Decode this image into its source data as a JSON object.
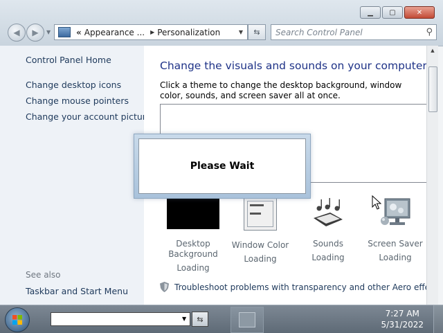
{
  "window": {
    "caption_buttons": [
      "minimize",
      "maximize",
      "close"
    ],
    "nav": {
      "back_icon": "back-arrow-icon",
      "forward_icon": "forward-arrow-icon"
    },
    "address": {
      "overflow": "«",
      "crumbs": [
        "Appearance ...",
        "Personalization"
      ]
    },
    "search": {
      "placeholder": "Search Control Panel"
    }
  },
  "left_pane": {
    "home": "Control Panel Home",
    "links": [
      "Change desktop icons",
      "Change mouse pointers",
      "Change your account picture"
    ],
    "see_also_heading": "See also",
    "see_also": [
      "Taskbar and Start Menu"
    ]
  },
  "content": {
    "heading": "Change the visuals and sounds on your computer",
    "instruction": "Click a theme to change the desktop background, window color, sounds, and screen saver all at once.",
    "tiles": [
      {
        "label": "Desktop Background",
        "status": "Loading"
      },
      {
        "label": "Window Color",
        "status": "Loading"
      },
      {
        "label": "Sounds",
        "status": "Loading"
      },
      {
        "label": "Screen Saver",
        "status": "Loading"
      }
    ],
    "aero_link": "Troubleshoot problems with transparency and other Aero effects"
  },
  "dialog": {
    "message": "Please Wait"
  },
  "taskbar": {
    "clock_time": "7:27 AM",
    "clock_date": "5/31/2022"
  },
  "colors": {
    "heading": "#1e3287",
    "link": "#1e395b",
    "taskbar": "#6b7681"
  }
}
